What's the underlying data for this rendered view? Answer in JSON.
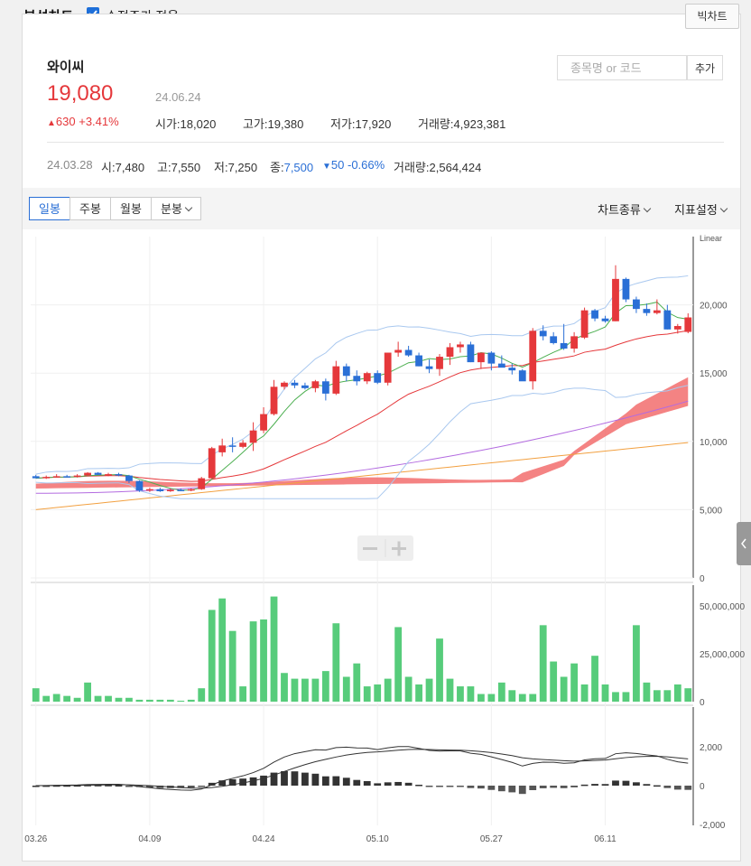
{
  "header": {
    "title": "분석차트",
    "adjusted_label": "수정주가 적용",
    "adjusted_checked": true,
    "big_chart_label": "빅차트"
  },
  "stock": {
    "name": "와이씨",
    "price": "19,080",
    "date": "24.06.24",
    "change": "630",
    "change_pct": "+3.41%",
    "open_label": "시가",
    "open": "18,020",
    "high_label": "고가",
    "high": "19,380",
    "low_label": "저가",
    "low": "17,920",
    "vol_label": "거래량",
    "volume": "4,923,381"
  },
  "search": {
    "placeholder": "종목명 or 코드",
    "add_label": "추가"
  },
  "previous": {
    "date": "24.03.28",
    "open_label": "시",
    "open": "7,480",
    "high_label": "고",
    "high": "7,550",
    "low_label": "저",
    "low": "7,250",
    "close_label": "종",
    "close": "7,500",
    "change": "50",
    "change_pct": "-0.66%",
    "vol_label": "거래량",
    "volume": "2,564,424"
  },
  "tabs": [
    {
      "label": "일봉",
      "active": true
    },
    {
      "label": "주봉"
    },
    {
      "label": "월봉"
    },
    {
      "label": "분봉"
    }
  ],
  "toolbar_right": {
    "chart_type": "차트종류",
    "indicator": "지표설정"
  },
  "colors": {
    "up": "#e5383b",
    "down": "#2a6fd6",
    "volume": "#57cc7b",
    "ma5": "#4caf50",
    "ma20": "#e5383b",
    "ma60": "#b36be0",
    "ma120": "#f2a040",
    "bollinger": "#a9c8ef",
    "cloud": "#f26d6d"
  },
  "chart_data": {
    "type": "candlestick",
    "scale_label": "Linear",
    "x_ticks": [
      "03.26",
      "04.09",
      "04.24",
      "05.10",
      "05.27",
      "06.11"
    ],
    "price_axis": {
      "ticks": [
        "20,000",
        "15,000",
        "10,000",
        "5,000",
        "0"
      ],
      "ylim": [
        0,
        25000
      ]
    },
    "volume_axis": {
      "ticks": [
        "50,000,000",
        "25,000,000",
        "0"
      ],
      "ylim": [
        0,
        60000000
      ]
    },
    "macd_axis": {
      "ticks": [
        "2,000",
        "0",
        "-2,000"
      ],
      "ylim": [
        -2000,
        2800
      ]
    },
    "candles": [
      [
        7450,
        7550,
        7300,
        7300
      ],
      [
        7300,
        7500,
        7250,
        7400
      ],
      [
        7400,
        7600,
        7350,
        7450
      ],
      [
        7450,
        7550,
        7380,
        7400
      ],
      [
        7400,
        7600,
        7350,
        7500
      ],
      [
        7500,
        7750,
        7450,
        7700
      ],
      [
        7700,
        7750,
        7550,
        7550
      ],
      [
        7550,
        7700,
        7450,
        7600
      ],
      [
        7600,
        7700,
        7450,
        7500
      ],
      [
        7500,
        7550,
        6950,
        7100
      ],
      [
        7100,
        7150,
        6300,
        6400
      ],
      [
        6400,
        6600,
        6300,
        6500
      ],
      [
        6500,
        6600,
        6300,
        6350
      ],
      [
        6350,
        6550,
        6300,
        6450
      ],
      [
        6450,
        6550,
        6350,
        6400
      ],
      [
        6400,
        6550,
        6350,
        6500
      ],
      [
        6500,
        7400,
        6450,
        7300
      ],
      [
        7300,
        9600,
        7250,
        9500
      ],
      [
        9200,
        10200,
        8900,
        9700
      ],
      [
        9700,
        10300,
        9200,
        9600
      ],
      [
        9600,
        10100,
        9500,
        9900
      ],
      [
        9900,
        11400,
        9300,
        10800
      ],
      [
        10800,
        12500,
        10600,
        12000
      ],
      [
        12000,
        14500,
        11900,
        14000
      ],
      [
        14000,
        14400,
        13800,
        14300
      ],
      [
        14300,
        14500,
        13900,
        14100
      ],
      [
        14100,
        14300,
        13800,
        13900
      ],
      [
        13900,
        14500,
        13600,
        14400
      ],
      [
        14400,
        14600,
        13000,
        13500
      ],
      [
        13500,
        15900,
        13400,
        15500
      ],
      [
        15500,
        15700,
        14400,
        14800
      ],
      [
        14800,
        15200,
        14100,
        14400
      ],
      [
        14400,
        15100,
        14200,
        15000
      ],
      [
        15000,
        15200,
        14200,
        14300
      ],
      [
        14300,
        16500,
        14100,
        16500
      ],
      [
        16500,
        17300,
        16200,
        16700
      ],
      [
        16700,
        17000,
        16200,
        16300
      ],
      [
        16300,
        16500,
        15500,
        15500
      ],
      [
        15500,
        16000,
        15000,
        15300
      ],
      [
        15300,
        16400,
        14800,
        16200
      ],
      [
        16200,
        17200,
        15600,
        16900
      ],
      [
        16900,
        17300,
        16500,
        17100
      ],
      [
        17100,
        17300,
        15800,
        15800
      ],
      [
        15800,
        16500,
        15300,
        16500
      ],
      [
        16500,
        16600,
        15200,
        15700
      ],
      [
        15700,
        16300,
        15500,
        15400
      ],
      [
        15400,
        15700,
        14900,
        15200
      ],
      [
        15200,
        15300,
        14600,
        14400
      ],
      [
        14400,
        18300,
        13800,
        18100
      ],
      [
        18100,
        18500,
        17400,
        17700
      ],
      [
        17700,
        18000,
        17100,
        17200
      ],
      [
        17200,
        18600,
        16700,
        16800
      ],
      [
        16800,
        18000,
        16500,
        17700
      ],
      [
        17600,
        19800,
        17500,
        19600
      ],
      [
        19600,
        19700,
        18800,
        19000
      ],
      [
        19000,
        19200,
        18700,
        18800
      ],
      [
        18800,
        22900,
        18800,
        21900
      ],
      [
        21900,
        22000,
        20200,
        20400
      ],
      [
        20400,
        20600,
        19400,
        19700
      ],
      [
        19700,
        20100,
        19200,
        19400
      ],
      [
        19400,
        20400,
        19300,
        19600
      ],
      [
        19600,
        20000,
        18200,
        18200
      ],
      [
        18200,
        18600,
        17900,
        18450
      ],
      [
        18020,
        19380,
        17920,
        19080
      ]
    ],
    "volumes": [
      7,
      3,
      4,
      3,
      2,
      10,
      3,
      3,
      2,
      2,
      1,
      1,
      1,
      1,
      0.5,
      1,
      7,
      48,
      54,
      37,
      8,
      42,
      43,
      55,
      15,
      12,
      12,
      12,
      16,
      41,
      13,
      20,
      8,
      9,
      12,
      39,
      13,
      9,
      12,
      33,
      12,
      8,
      8,
      4,
      4,
      10,
      6,
      4,
      4,
      40,
      21,
      13,
      20,
      9,
      24,
      9,
      5,
      5,
      40,
      10,
      6,
      6,
      9,
      7
    ]
  }
}
